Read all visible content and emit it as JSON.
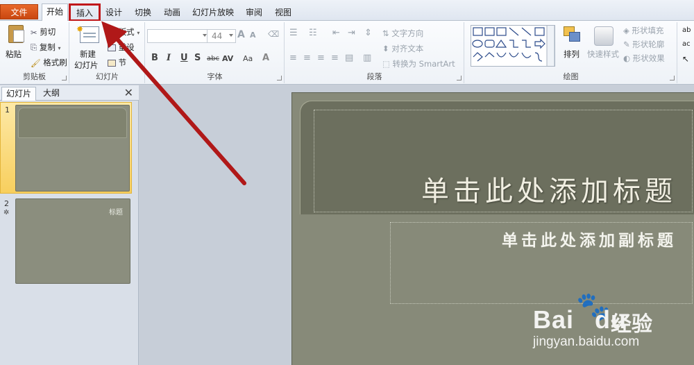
{
  "tabs": {
    "file": "文件",
    "home": "开始",
    "insert": "插入",
    "design": "设计",
    "transitions": "切换",
    "animations": "动画",
    "slideshow": "幻灯片放映",
    "review": "审阅",
    "view": "视图"
  },
  "clipboard": {
    "paste": "粘贴",
    "cut": "剪切",
    "copy": "复制",
    "format_painter": "格式刷",
    "label": "剪贴板"
  },
  "slides_group": {
    "new_slide_line1": "新建",
    "new_slide_line2": "幻灯片",
    "layout": "版式",
    "reset": "重设",
    "section": "节",
    "label": "幻灯片"
  },
  "font_group": {
    "font_size": "44",
    "bold": "B",
    "italic": "I",
    "underline": "U",
    "shadow": "S",
    "strike": "abc",
    "spacing": "AV",
    "case": "Aa",
    "color": "A",
    "grow": "A",
    "shrink": "A",
    "label": "字体"
  },
  "paragraph_group": {
    "text_direction": "文字方向",
    "align_text": "对齐文本",
    "convert_smartart": "转换为 SmartArt",
    "label": "段落"
  },
  "drawing_group": {
    "arrange": "排列",
    "quick_styles": "快速样式",
    "shape_fill": "形状填充",
    "shape_outline": "形状轮廓",
    "shape_effects": "形状效果",
    "label": "绘图"
  },
  "left_pane": {
    "tab_slides": "幻灯片",
    "tab_outline": "大纲",
    "close": "✕",
    "slide1_num": "1",
    "slide2_num": "2",
    "thumb2_title": "标题"
  },
  "slide": {
    "title_placeholder": "单击此处添加标题",
    "subtitle_placeholder": "单击此处添加副标题"
  },
  "watermark": {
    "logo": "Bai",
    "logo2": "du",
    "jingyan": "经验",
    "url": "jingyan.baidu.com"
  },
  "colors": {
    "file_tab": "#d4551a",
    "highlight_box": "#c0181a",
    "arrow": "#b01818",
    "slide_bg": "#878a79",
    "title_band": "#6c6f5e"
  }
}
